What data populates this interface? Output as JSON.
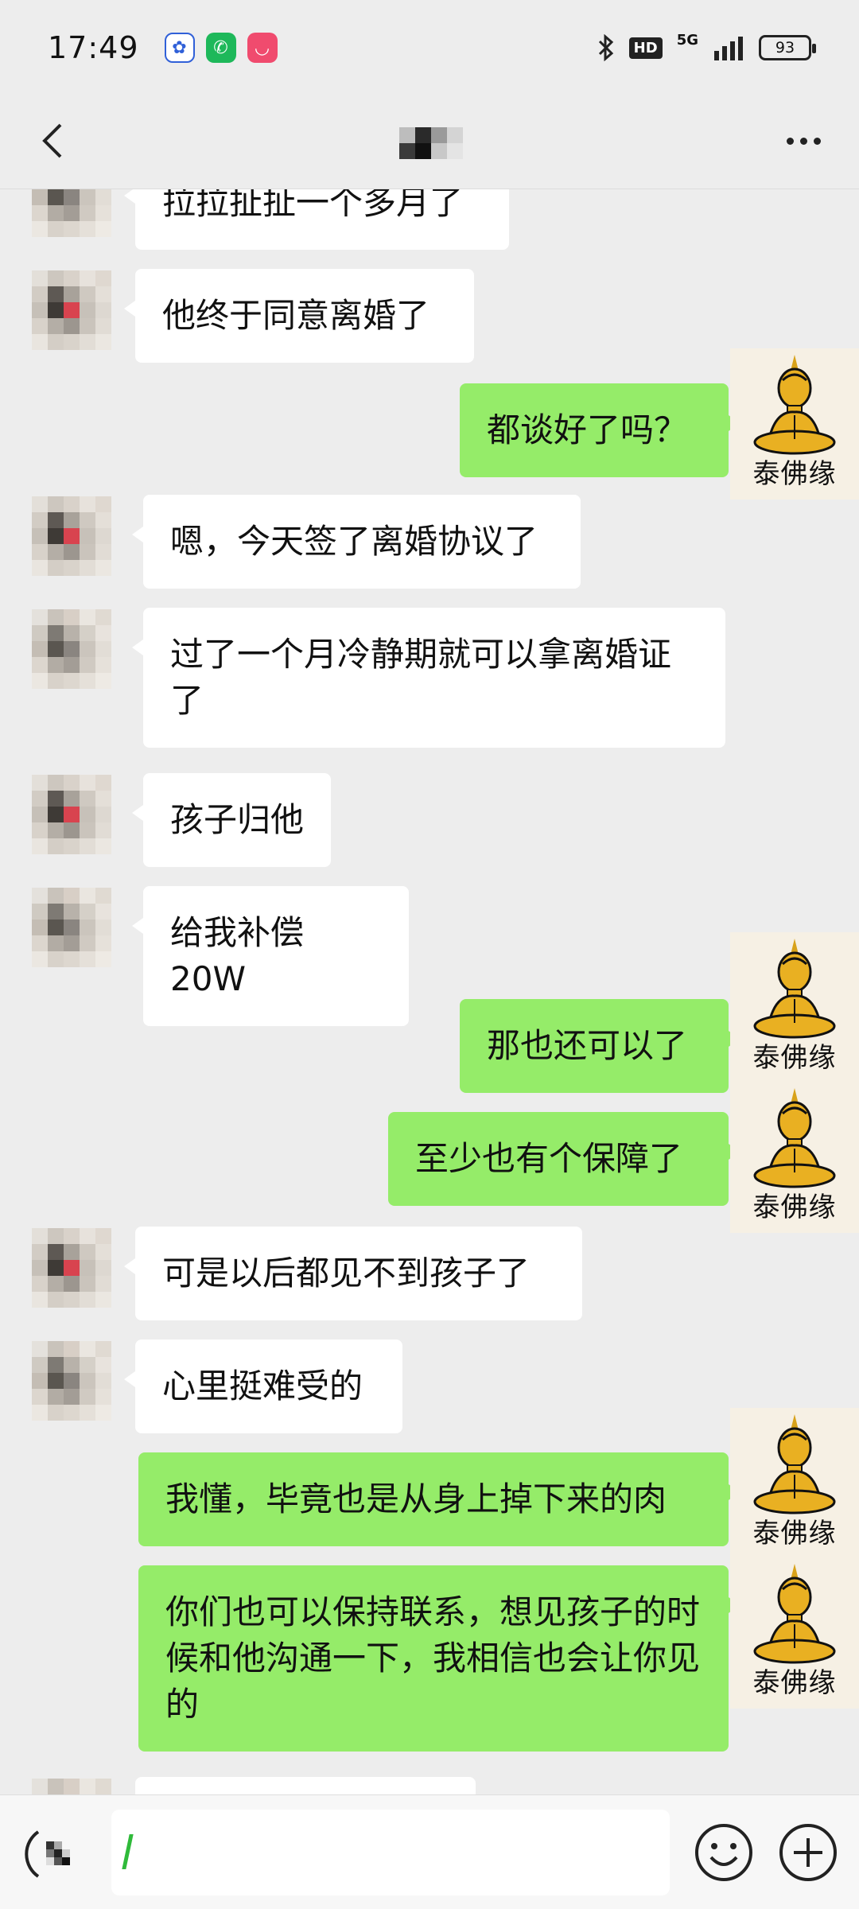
{
  "status": {
    "time": "17:49",
    "hd": "HD",
    "network": "5G",
    "battery": "93",
    "app_icons": [
      "baidu-icon",
      "phone-icon",
      "pink-app-icon"
    ]
  },
  "nav": {
    "back_icon": "chevron-left-icon",
    "more_icon": "more-dots-icon"
  },
  "my_avatar_caption": "泰佛缘",
  "messages": [
    {
      "side": "left",
      "text": "拉拉扯扯一个多月了"
    },
    {
      "side": "left",
      "text": "他终于同意离婚了"
    },
    {
      "side": "right",
      "text": "都谈好了吗？"
    },
    {
      "side": "left",
      "text": "嗯，今天签了离婚协议了"
    },
    {
      "side": "left",
      "text": "过了一个月冷静期就可以拿离婚证了"
    },
    {
      "side": "left",
      "text": "孩子归他"
    },
    {
      "side": "left",
      "text": "给我补偿 20W"
    },
    {
      "side": "right",
      "text": "那也还可以了"
    },
    {
      "side": "right",
      "text": "至少也有个保障了"
    },
    {
      "side": "left",
      "text": "可是以后都见不到孩子了"
    },
    {
      "side": "left",
      "text": "心里挺难受的"
    },
    {
      "side": "right",
      "text": "我懂，毕竟也是从身上掉下来的肉"
    },
    {
      "side": "right",
      "text": "你们也可以保持联系，想见孩子的时候和他沟通一下，我相信也会让你见的"
    }
  ],
  "input": {
    "value": "",
    "voice_icon": "voice-icon",
    "emoji_icon": "emoji-icon",
    "plus_icon": "plus-icon"
  },
  "colors": {
    "background": "#ededed",
    "bubble_self": "#95ec69",
    "bubble_other": "#ffffff",
    "caret": "#2fba3a"
  }
}
